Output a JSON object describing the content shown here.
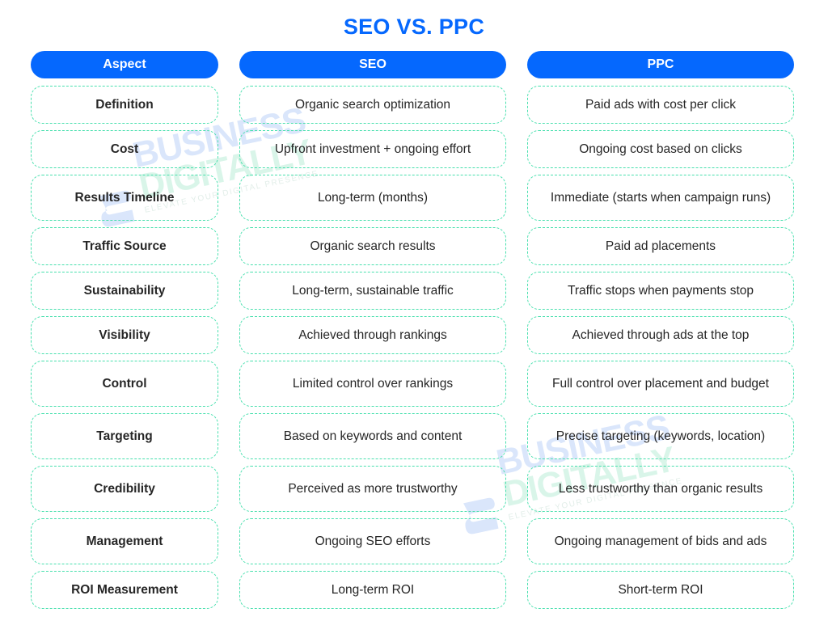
{
  "title": "SEO VS. PPC",
  "colors": {
    "accent_blue": "#0568fe",
    "cell_border_green": "#49e0ae",
    "text_dark": "#262626",
    "background": "#ffffff"
  },
  "headers": {
    "aspect": "Aspect",
    "seo": "SEO",
    "ppc": "PPC"
  },
  "watermark": {
    "word1": "BUSINESS",
    "word2": "DIGITALLY",
    "tagline": "ELEVATE YOUR DIGITAL PRESENCE"
  },
  "rows": [
    {
      "aspect": "Definition",
      "seo": "Organic search optimization",
      "ppc": "Paid ads with cost per click",
      "tall": false
    },
    {
      "aspect": "Cost",
      "seo": "Upfront investment + ongoing effort",
      "ppc": "Ongoing cost based on clicks",
      "tall": false
    },
    {
      "aspect": "Results Timeline",
      "seo": "Long-term (months)",
      "ppc": "Immediate (starts when campaign runs)",
      "tall": true
    },
    {
      "aspect": "Traffic Source",
      "seo": "Organic search results",
      "ppc": "Paid ad placements",
      "tall": false
    },
    {
      "aspect": "Sustainability",
      "seo": "Long-term, sustainable traffic",
      "ppc": "Traffic stops when payments stop",
      "tall": false
    },
    {
      "aspect": "Visibility",
      "seo": "Achieved through rankings",
      "ppc": "Achieved through ads at the top",
      "tall": false
    },
    {
      "aspect": "Control",
      "seo": "Limited control over rankings",
      "ppc": "Full control over placement and budget",
      "tall": true
    },
    {
      "aspect": "Targeting",
      "seo": "Based on keywords and content",
      "ppc": "Precise targeting (keywords, location)",
      "tall": true
    },
    {
      "aspect": "Credibility",
      "seo": "Perceived as more trustworthy",
      "ppc": "Less trustworthy than organic results",
      "tall": true
    },
    {
      "aspect": "Management",
      "seo": "Ongoing SEO efforts",
      "ppc": "Ongoing management of bids and ads",
      "tall": true
    },
    {
      "aspect": "ROI Measurement",
      "seo": "Long-term ROI",
      "ppc": "Short-term ROI",
      "tall": false
    }
  ]
}
